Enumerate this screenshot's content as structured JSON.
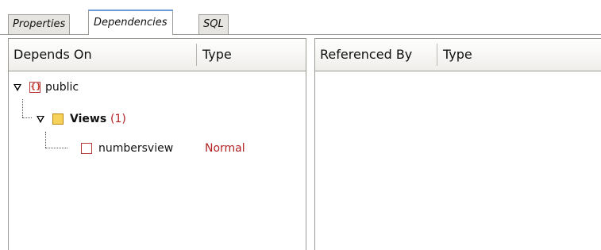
{
  "tabs": [
    {
      "label": "Properties"
    },
    {
      "label": "Dependencies",
      "active": true
    },
    {
      "label": "SQL"
    }
  ],
  "left_panel": {
    "columns": [
      "Depends On",
      "Type"
    ],
    "tree": {
      "schema": {
        "name": "public"
      },
      "group": {
        "name": "Views",
        "count": "(1)"
      },
      "item": {
        "name": "numbersview",
        "type": "Normal"
      }
    }
  },
  "right_panel": {
    "columns": [
      "Referenced By",
      "Type"
    ]
  },
  "colors": {
    "accent_tab": "#6b9ad8",
    "type_text": "#b22222",
    "border": "#9c9a94"
  },
  "icons": {
    "expand": "triangle-down-icon",
    "schema": "schema-icon",
    "folder": "views-folder-icon",
    "view": "view-icon"
  }
}
